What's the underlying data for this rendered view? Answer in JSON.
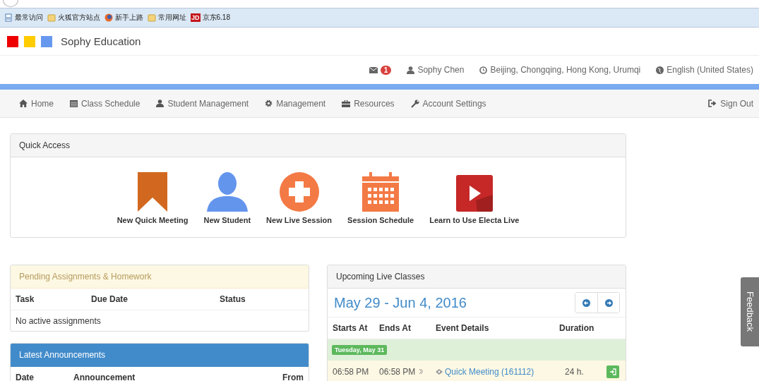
{
  "browser": {
    "bookmarks": [
      {
        "label": "最常访问",
        "kind": "page"
      },
      {
        "label": "火狐官方站点",
        "kind": "folder"
      },
      {
        "label": "新手上路",
        "kind": "globe"
      },
      {
        "label": "常用网址",
        "kind": "folder"
      },
      {
        "label": "京东6.18",
        "kind": "jd",
        "mark": "JD"
      }
    ]
  },
  "header": {
    "logo": [
      {
        "color": "#ee0000"
      },
      {
        "color": "#ffcc00"
      },
      {
        "color": "#6699ee"
      }
    ],
    "brand": "Sophy Education"
  },
  "topbar": {
    "mail_count": "1",
    "user": "Sophy Chen",
    "timezone": "Beijing, Chongqing, Hong Kong, Urumqi",
    "language": "English (United States)"
  },
  "nav": {
    "items": [
      {
        "label": "Home",
        "kind": "home"
      },
      {
        "label": "Class Schedule",
        "kind": "calendar"
      },
      {
        "label": "Student Management",
        "kind": "user"
      },
      {
        "label": "Management",
        "kind": "gear"
      },
      {
        "label": "Resources",
        "kind": "briefcase"
      },
      {
        "label": "Account Settings",
        "kind": "wrench"
      }
    ],
    "sign_out": "Sign Out"
  },
  "quick_access": {
    "title": "Quick Access",
    "items": [
      {
        "label": "New Quick Meeting",
        "kind": "bookmark"
      },
      {
        "label": "New Student",
        "kind": "person"
      },
      {
        "label": "New Live Session",
        "kind": "plus"
      },
      {
        "label": "Session Schedule",
        "kind": "calendar"
      },
      {
        "label": "Learn to Use Electa Live",
        "kind": "play"
      }
    ]
  },
  "pending": {
    "title": "Pending Assignments & Homework",
    "columns": [
      "Task",
      "Due Date",
      "Status"
    ],
    "empty": "No active assignments"
  },
  "announcements": {
    "title": "Latest Announcements",
    "columns": [
      "Date",
      "Announcement",
      "From"
    ]
  },
  "upcoming": {
    "title": "Upcoming Live Classes",
    "range": "May 29 - Jun 4, 2016",
    "columns": [
      "Starts At",
      "Ends At",
      "Event Details",
      "Duration"
    ],
    "days": [
      {
        "label": "Tuesday, May 31",
        "events": [
          {
            "start": "06:58 PM",
            "end": "06:58 PM",
            "title": "Quick Meeting (161112)",
            "duration": "24 h."
          }
        ]
      }
    ]
  },
  "feedback": "Feedback"
}
